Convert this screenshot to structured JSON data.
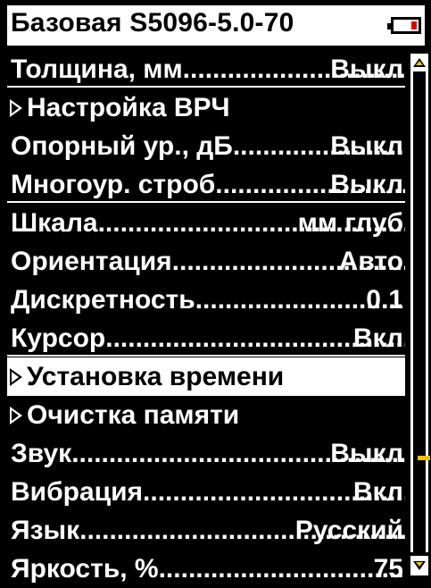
{
  "header": {
    "title": "Базовая S5096-5.0-70",
    "battery_color": "#e00000"
  },
  "menu": [
    {
      "label": "Толщина, мм",
      "value": "Выкл",
      "dots": true
    },
    {
      "label": "Настройка ВРЧ",
      "value": "",
      "arrow": true
    },
    {
      "label": "Опорный ур., дБ",
      "value": "Выкл",
      "dots": true
    },
    {
      "label": "Многоур. строб",
      "value": "Выкл",
      "dots": true
    },
    {
      "label": "Шкала",
      "value": "мм глуб",
      "dots": true
    },
    {
      "label": "Ориентация",
      "value": "Авто",
      "dots": true
    },
    {
      "label": "Дискретность",
      "value": "0.1",
      "dots": true
    },
    {
      "label": "Курсор",
      "value": "Вкл",
      "dots": true
    },
    {
      "label": "Установка времени",
      "value": "",
      "arrow": true,
      "selected": true
    },
    {
      "label": "Очистка памяти",
      "value": "",
      "arrow": true
    },
    {
      "label": "Звук",
      "value": "Выкл",
      "dots": true
    },
    {
      "label": "Вибрация",
      "value": "Вкл",
      "dots": true
    },
    {
      "label": "Язык",
      "value": "Русский",
      "dots": true
    },
    {
      "label": "Яркость, %",
      "value": "75",
      "dots": true
    }
  ],
  "scrollbar": {
    "up_icon": "scroll-up-arrow-icon",
    "down_icon": "scroll-down-arrow-icon",
    "thumb_color": "#f2c200"
  }
}
